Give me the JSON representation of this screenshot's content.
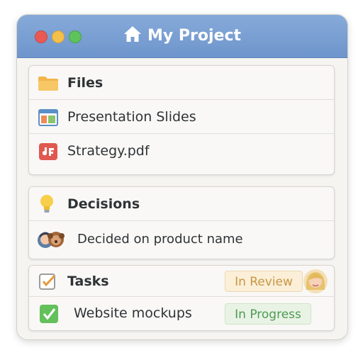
{
  "window": {
    "title": "My Project",
    "title_icon": "home-icon"
  },
  "files": {
    "header": "Files",
    "items": [
      {
        "label": "Presentation Slides",
        "icon": "presentation-icon"
      },
      {
        "label": "Strategy.pdf",
        "icon": "pdf-icon"
      }
    ]
  },
  "decisions": {
    "header": "Decisions",
    "items": [
      {
        "label": "Decided on product name",
        "icon": "avatars-icon"
      }
    ]
  },
  "tasks": {
    "header": "Tasks",
    "header_status": "In Review",
    "items": [
      {
        "label": "Website mockups",
        "status": "In Progress",
        "done": true
      }
    ]
  },
  "colors": {
    "titlebar": "#7aa0d4",
    "review": "#c89544",
    "progress": "#4d9a52"
  }
}
